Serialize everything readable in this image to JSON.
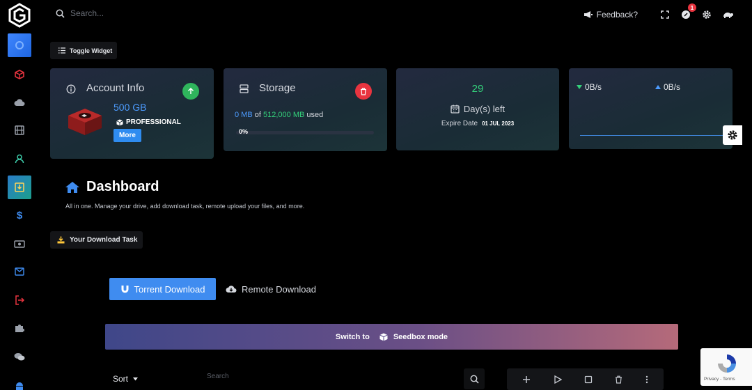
{
  "topbar": {
    "search_placeholder": "Search...",
    "feedback_label": "Feedback?",
    "notification_count": "1"
  },
  "toggle_widget_label": "Toggle Widget",
  "account_card": {
    "title": "Account Info",
    "storage_size": "500 GB",
    "plan": "PROFESSIONAL",
    "more_label": "More"
  },
  "storage_card": {
    "title": "Storage",
    "used": "0 MB",
    "of_label": "of",
    "total": "512,000 MB",
    "used_label": "used",
    "percent": "0%",
    "progress_fraction": 0
  },
  "expiry_card": {
    "days": "29",
    "days_label": "Day(s) left",
    "expire_label": "Expire Date",
    "expire_date": "01 JUL 2023"
  },
  "speed_card": {
    "download": "0B/s",
    "upload": "0B/s"
  },
  "dashboard": {
    "title": "Dashboard",
    "subtitle": "All in one. Manage your drive, add download task, remote upload your files, and more."
  },
  "download_task_label": "Your Download Task",
  "tabs": {
    "torrent": "Torrent Download",
    "remote": "Remote Download"
  },
  "seedbox": {
    "prefix": "Switch to",
    "mode": "Seedbox mode"
  },
  "list": {
    "sort_label": "Sort",
    "search_placeholder": "Search"
  },
  "recaptcha": {
    "privacy": "Privacy",
    "separator": " - ",
    "terms": "Terms"
  },
  "colors": {
    "accent_blue": "#3f8cf0",
    "success_green": "#34d17b",
    "danger_red": "#e8343f"
  }
}
